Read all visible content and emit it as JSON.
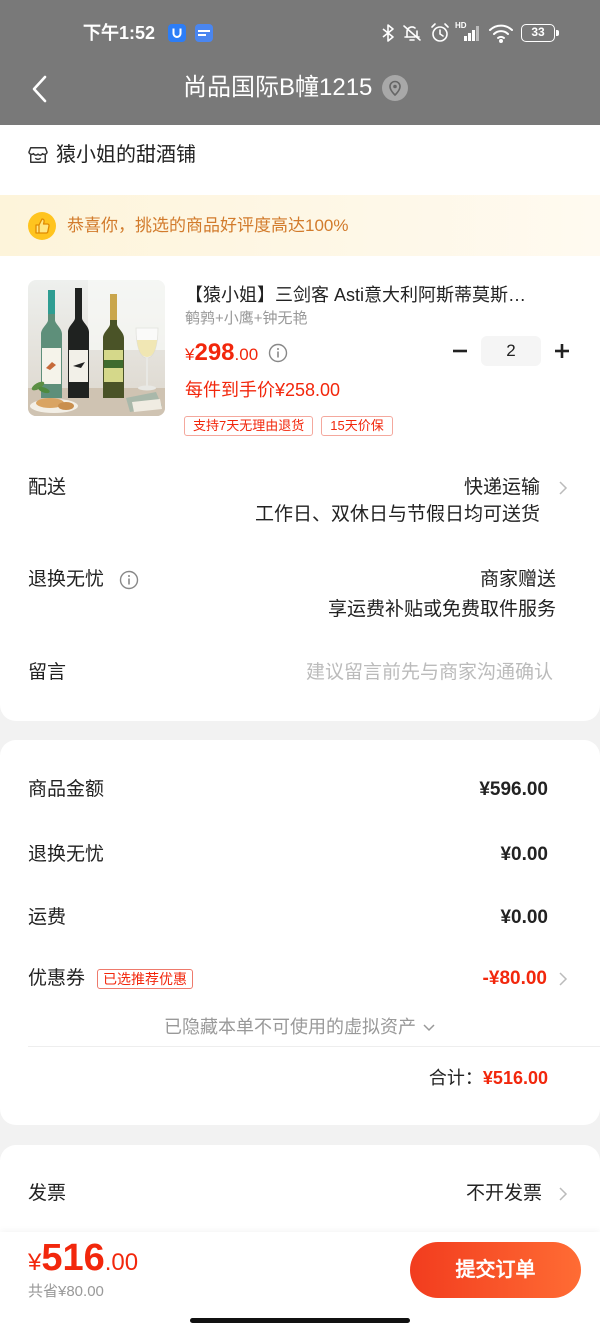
{
  "colors": {
    "header_bg": "#797979",
    "page_bg": "#f2f2f2",
    "accent_red": "#f2270c",
    "banner_text": "#d27b2c",
    "banner_bg": "#fdf4da",
    "banner_icon": "#ffc41f",
    "button_start": "#f23c1e",
    "button_end": "#ff6c34"
  },
  "status_bar": {
    "time": "下午1:52",
    "signal_label": "HD",
    "battery": "33",
    "icons": [
      "u-app-icon",
      "jdm-app-icon",
      "bluetooth-icon",
      "bell-off-icon",
      "alarm-icon",
      "signal-icon",
      "wifi-icon",
      "battery-icon"
    ]
  },
  "header": {
    "back_icon": "chevron-left-icon",
    "title": "尚品国际B幢1215",
    "location_icon": "location-pin-icon"
  },
  "shop": {
    "icon": "store-icon",
    "name": "猿小姐的甜酒铺"
  },
  "banner": {
    "icon": "thumbs-up-icon",
    "text": "恭喜你，挑选的商品好评度高达100%"
  },
  "product": {
    "title": "【猿小姐】三剑客 Asti意大利阿斯蒂莫斯…",
    "variant": "鹌鹑+小鹰+钟无艳",
    "price": {
      "symbol": "¥",
      "integer": "298",
      "decimal": ".00"
    },
    "final_price": "每件到手价¥258.00",
    "quantity": "2",
    "tags": [
      "支持7天无理由退货",
      "15天价保"
    ]
  },
  "delivery": {
    "label": "配送",
    "method": "快递运输",
    "note": "工作日、双休日与节假日均可送货"
  },
  "return_service": {
    "label": "退换无忧",
    "value": "商家赠送",
    "note": "享运费补贴或免费取件服务"
  },
  "message": {
    "label": "留言",
    "placeholder": "建议留言前先与商家沟通确认"
  },
  "summary": {
    "rows": [
      {
        "label": "商品金额",
        "value": "¥596.00"
      },
      {
        "label": "退换无忧",
        "value": "¥0.00"
      },
      {
        "label": "运费",
        "value": "¥0.00"
      }
    ],
    "coupon": {
      "label": "优惠券",
      "badge": "已选推荐优惠",
      "value": "-¥80.00"
    },
    "hidden_assets": "已隐藏本单不可使用的虚拟资产",
    "total_label": "合计：",
    "total_value": "¥516.00"
  },
  "invoice": {
    "label": "发票",
    "value": "不开发票"
  },
  "footer": {
    "total": {
      "symbol": "¥",
      "integer": "516",
      "decimal": ".00"
    },
    "saved": "共省¥80.00",
    "submit_label": "提交订单"
  }
}
